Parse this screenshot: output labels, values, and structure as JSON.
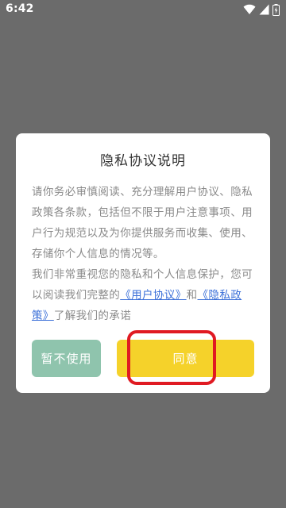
{
  "status_bar": {
    "time": "6:42",
    "icons": [
      "wifi-icon",
      "cell-signal-icon",
      "battery-icon"
    ]
  },
  "dialog": {
    "title": "隐私协议说明",
    "paragraph1": "请你务必审慎阅读、充分理解用户协议、隐私政策各条款，包括但不限于用户注意事项、用户行为规范以及为你提供服务而收集、使用、存储你个人信息的情况等。",
    "paragraph2_prefix": "我们非常重视您的隐私和个人信息保护，您可以阅读我们完整的",
    "user_agreement_link": "《用户协议》",
    "and_text": "和",
    "privacy_policy_link": "《隐私政策》",
    "paragraph2_suffix": "了解我们的承诺",
    "decline_label": "暂不使用",
    "agree_label": "同意"
  },
  "colors": {
    "overlay": "#6b6b6b",
    "decline_button": "#8fc4ad",
    "agree_button": "#f5d22a",
    "link": "#3a6fd8",
    "highlight": "#e01a22"
  }
}
